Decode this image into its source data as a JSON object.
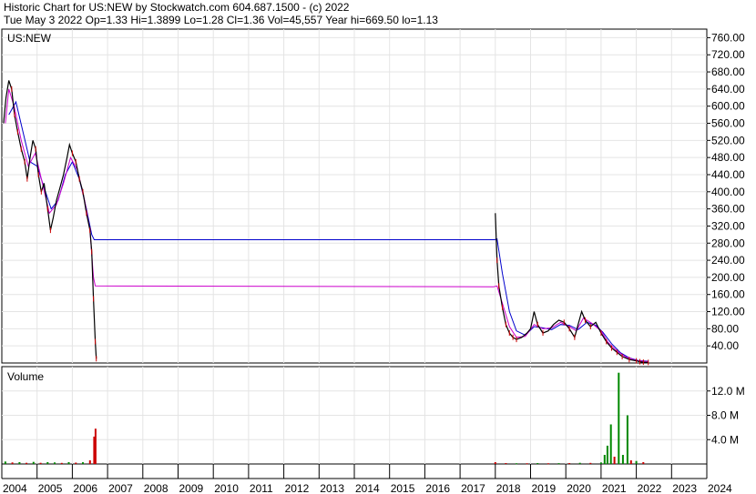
{
  "header": {
    "line1": "Historic Chart for US:NEW by Stockwatch.com 604.687.1500 - (c) 2022",
    "line2": "Tue May  3 2022  Op=1.33  Hi=1.3899  Lo=1.28  Cl=1.36  Vol=45,557  Year hi=669.50  lo=1.13"
  },
  "colors": {
    "price": "#000000",
    "price_down": "#cc0000",
    "ma_short": "#cc00cc",
    "ma_long": "#0000cc",
    "volume_up": "#008800",
    "volume_down": "#cc0000",
    "grid": "#e4e4e4"
  },
  "chart_data": [
    {
      "type": "line",
      "title": "US:NEW",
      "ylim": [
        0,
        780
      ],
      "ytick_labels": [
        "40.00",
        "80.00",
        "120.00",
        "160.00",
        "200.00",
        "240.00",
        "280.00",
        "320.00",
        "360.00",
        "400.00",
        "440.00",
        "480.00",
        "520.00",
        "560.00",
        "600.00",
        "640.00",
        "680.00",
        "720.00",
        "760.00"
      ],
      "xtick_labels": [
        "2004",
        "2005",
        "2006",
        "2007",
        "2008",
        "2009",
        "2010",
        "2011",
        "2012",
        "2013",
        "2014",
        "2015",
        "2016",
        "2017",
        "2018",
        "2019",
        "2020",
        "2021",
        "2022",
        "2023",
        "2024"
      ],
      "xlim": [
        2004.0,
        2024.0
      ],
      "series": [
        {
          "role": "price",
          "points": [
            [
              2004.05,
              560
            ],
            [
              2004.12,
              620
            ],
            [
              2004.2,
              660
            ],
            [
              2004.28,
              640
            ],
            [
              2004.36,
              580
            ],
            [
              2004.45,
              540
            ],
            [
              2004.55,
              500
            ],
            [
              2004.65,
              470
            ],
            [
              2004.72,
              430
            ],
            [
              2004.8,
              480
            ],
            [
              2004.88,
              520
            ],
            [
              2004.96,
              500
            ],
            [
              2005.04,
              440
            ],
            [
              2005.12,
              400
            ],
            [
              2005.2,
              420
            ],
            [
              2005.3,
              360
            ],
            [
              2005.38,
              310
            ],
            [
              2005.46,
              340
            ],
            [
              2005.55,
              380
            ],
            [
              2005.65,
              410
            ],
            [
              2005.75,
              440
            ],
            [
              2005.85,
              480
            ],
            [
              2005.92,
              510
            ],
            [
              2006.0,
              490
            ],
            [
              2006.1,
              470
            ],
            [
              2006.2,
              430
            ],
            [
              2006.3,
              400
            ],
            [
              2006.4,
              350
            ],
            [
              2006.5,
              310
            ],
            [
              2006.55,
              260
            ],
            [
              2006.6,
              150
            ],
            [
              2006.65,
              50
            ],
            [
              2006.68,
              10
            ],
            [
              2018.0,
              350
            ],
            [
              2018.05,
              240
            ],
            [
              2018.1,
              180
            ],
            [
              2018.2,
              130
            ],
            [
              2018.3,
              90
            ],
            [
              2018.4,
              70
            ],
            [
              2018.5,
              60
            ],
            [
              2018.6,
              55
            ],
            [
              2018.75,
              60
            ],
            [
              2018.9,
              70
            ],
            [
              2019.0,
              80
            ],
            [
              2019.1,
              120
            ],
            [
              2019.2,
              90
            ],
            [
              2019.35,
              70
            ],
            [
              2019.5,
              75
            ],
            [
              2019.65,
              90
            ],
            [
              2019.8,
              100
            ],
            [
              2019.95,
              95
            ],
            [
              2020.1,
              80
            ],
            [
              2020.25,
              60
            ],
            [
              2020.35,
              90
            ],
            [
              2020.45,
              120
            ],
            [
              2020.55,
              100
            ],
            [
              2020.7,
              85
            ],
            [
              2020.85,
              95
            ],
            [
              2021.0,
              70
            ],
            [
              2021.15,
              50
            ],
            [
              2021.3,
              35
            ],
            [
              2021.45,
              25
            ],
            [
              2021.6,
              15
            ],
            [
              2021.8,
              8
            ],
            [
              2022.0,
              5
            ],
            [
              2022.1,
              3
            ],
            [
              2022.2,
              2
            ],
            [
              2022.34,
              1.36
            ]
          ]
        },
        {
          "role": "ma_short",
          "points": [
            [
              2004.1,
              560
            ],
            [
              2004.2,
              640
            ],
            [
              2004.35,
              600
            ],
            [
              2004.55,
              520
            ],
            [
              2004.75,
              460
            ],
            [
              2004.95,
              490
            ],
            [
              2005.15,
              420
            ],
            [
              2005.35,
              350
            ],
            [
              2005.55,
              370
            ],
            [
              2005.75,
              420
            ],
            [
              2005.95,
              480
            ],
            [
              2006.15,
              450
            ],
            [
              2006.35,
              380
            ],
            [
              2006.5,
              310
            ],
            [
              2006.6,
              200
            ],
            [
              2006.65,
              180
            ],
            [
              2017.95,
              178
            ],
            [
              2018.05,
              180
            ],
            [
              2018.2,
              140
            ],
            [
              2018.4,
              85
            ],
            [
              2018.6,
              60
            ],
            [
              2018.85,
              62
            ],
            [
              2019.1,
              90
            ],
            [
              2019.35,
              80
            ],
            [
              2019.6,
              82
            ],
            [
              2019.85,
              95
            ],
            [
              2020.1,
              85
            ],
            [
              2020.3,
              75
            ],
            [
              2020.5,
              105
            ],
            [
              2020.75,
              92
            ],
            [
              2021.0,
              75
            ],
            [
              2021.2,
              48
            ],
            [
              2021.45,
              28
            ],
            [
              2021.7,
              14
            ],
            [
              2022.0,
              6
            ],
            [
              2022.34,
              3
            ]
          ]
        },
        {
          "role": "ma_long",
          "points": [
            [
              2004.2,
              580
            ],
            [
              2004.4,
              610
            ],
            [
              2004.6,
              540
            ],
            [
              2004.8,
              470
            ],
            [
              2005.0,
              460
            ],
            [
              2005.2,
              410
            ],
            [
              2005.4,
              360
            ],
            [
              2005.6,
              380
            ],
            [
              2005.8,
              440
            ],
            [
              2006.0,
              470
            ],
            [
              2006.2,
              430
            ],
            [
              2006.4,
              360
            ],
            [
              2006.55,
              300
            ],
            [
              2006.62,
              288
            ],
            [
              2017.98,
              288
            ],
            [
              2018.05,
              290
            ],
            [
              2018.2,
              210
            ],
            [
              2018.4,
              120
            ],
            [
              2018.6,
              75
            ],
            [
              2018.85,
              65
            ],
            [
              2019.1,
              85
            ],
            [
              2019.35,
              82
            ],
            [
              2019.6,
              78
            ],
            [
              2019.85,
              90
            ],
            [
              2020.1,
              88
            ],
            [
              2020.35,
              78
            ],
            [
              2020.6,
              95
            ],
            [
              2020.85,
              88
            ],
            [
              2021.05,
              72
            ],
            [
              2021.3,
              45
            ],
            [
              2021.55,
              24
            ],
            [
              2021.8,
              12
            ],
            [
              2022.05,
              6
            ],
            [
              2022.34,
              4
            ]
          ]
        }
      ]
    },
    {
      "type": "bar",
      "title": "Volume",
      "ylim": [
        0,
        16000000
      ],
      "ytick_labels": [
        "4.0 M",
        "8.0 M",
        "12.0 M"
      ],
      "xlim": [
        2004.0,
        2024.0
      ],
      "bars": [
        {
          "x": 2004.1,
          "v": 400000,
          "dir": "up"
        },
        {
          "x": 2004.3,
          "v": 250000,
          "dir": "down"
        },
        {
          "x": 2004.5,
          "v": 300000,
          "dir": "up"
        },
        {
          "x": 2004.7,
          "v": 200000,
          "dir": "down"
        },
        {
          "x": 2004.9,
          "v": 350000,
          "dir": "up"
        },
        {
          "x": 2005.1,
          "v": 200000,
          "dir": "down"
        },
        {
          "x": 2005.3,
          "v": 300000,
          "dir": "up"
        },
        {
          "x": 2005.5,
          "v": 250000,
          "dir": "up"
        },
        {
          "x": 2005.7,
          "v": 180000,
          "dir": "down"
        },
        {
          "x": 2005.9,
          "v": 300000,
          "dir": "up"
        },
        {
          "x": 2006.1,
          "v": 220000,
          "dir": "down"
        },
        {
          "x": 2006.3,
          "v": 280000,
          "dir": "up"
        },
        {
          "x": 2006.5,
          "v": 600000,
          "dir": "down"
        },
        {
          "x": 2006.62,
          "v": 4500000,
          "dir": "down"
        },
        {
          "x": 2006.66,
          "v": 5800000,
          "dir": "down"
        },
        {
          "x": 2018.0,
          "v": 300000,
          "dir": "down"
        },
        {
          "x": 2018.3,
          "v": 150000,
          "dir": "down"
        },
        {
          "x": 2018.6,
          "v": 120000,
          "dir": "up"
        },
        {
          "x": 2018.9,
          "v": 120000,
          "dir": "down"
        },
        {
          "x": 2019.2,
          "v": 150000,
          "dir": "up"
        },
        {
          "x": 2019.5,
          "v": 120000,
          "dir": "down"
        },
        {
          "x": 2019.8,
          "v": 130000,
          "dir": "up"
        },
        {
          "x": 2020.1,
          "v": 150000,
          "dir": "down"
        },
        {
          "x": 2020.4,
          "v": 200000,
          "dir": "up"
        },
        {
          "x": 2020.7,
          "v": 180000,
          "dir": "down"
        },
        {
          "x": 2021.0,
          "v": 250000,
          "dir": "up"
        },
        {
          "x": 2021.1,
          "v": 1500000,
          "dir": "up"
        },
        {
          "x": 2021.18,
          "v": 3000000,
          "dir": "up"
        },
        {
          "x": 2021.28,
          "v": 6500000,
          "dir": "up"
        },
        {
          "x": 2021.38,
          "v": 1200000,
          "dir": "down"
        },
        {
          "x": 2021.5,
          "v": 15000000,
          "dir": "up"
        },
        {
          "x": 2021.62,
          "v": 1500000,
          "dir": "up"
        },
        {
          "x": 2021.75,
          "v": 8000000,
          "dir": "up"
        },
        {
          "x": 2021.85,
          "v": 600000,
          "dir": "down"
        },
        {
          "x": 2022.0,
          "v": 500000,
          "dir": "up"
        },
        {
          "x": 2022.2,
          "v": 300000,
          "dir": "down"
        }
      ]
    }
  ]
}
